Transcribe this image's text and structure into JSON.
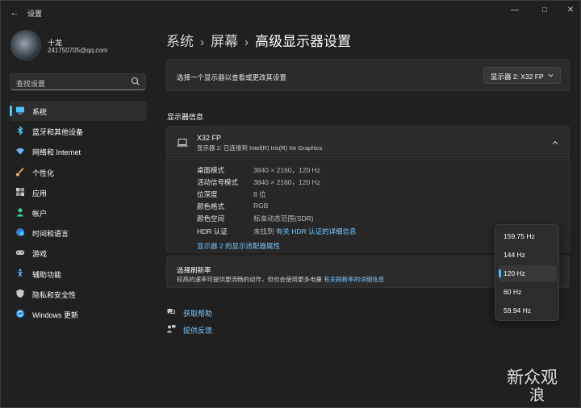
{
  "window": {
    "title": "设置"
  },
  "profile": {
    "name": "十龙",
    "email": "241750705@qq.com"
  },
  "search": {
    "placeholder": "查找设置"
  },
  "sidebar": {
    "items": [
      {
        "label": "系统",
        "icon": "monitor-icon",
        "color": "#4cc2ff"
      },
      {
        "label": "蓝牙和其他设备",
        "icon": "bluetooth-icon",
        "color": "#4cc2ff"
      },
      {
        "label": "网络和 Internet",
        "icon": "wifi-icon",
        "color": "#6fb4ff"
      },
      {
        "label": "个性化",
        "icon": "brush-icon",
        "color": "#f0a050"
      },
      {
        "label": "应用",
        "icon": "apps-icon",
        "color": "#c8c8c8"
      },
      {
        "label": "帐户",
        "icon": "person-icon",
        "color": "#3ccf8e"
      },
      {
        "label": "时间和语言",
        "icon": "globe-clock-icon",
        "color": "#4cc2ff"
      },
      {
        "label": "游戏",
        "icon": "gamepad-icon",
        "color": "#c8c8c8"
      },
      {
        "label": "辅助功能",
        "icon": "accessibility-icon",
        "color": "#5fb0ff"
      },
      {
        "label": "隐私和安全性",
        "icon": "shield-icon",
        "color": "#c8c8c8"
      },
      {
        "label": "Windows 更新",
        "icon": "sync-icon",
        "color": "#4cc2ff"
      }
    ]
  },
  "breadcrumb": {
    "part1": "系统",
    "part2": "屏幕",
    "current": "高级显示器设置"
  },
  "select_display": {
    "label": "选择一个显示器以查看或更改其设置",
    "value": "显示器 2: X32 FP"
  },
  "display_info": {
    "section_title": "显示器信息",
    "name": "X32 FP",
    "connection": "显示器 2: 已连接到 Intel(R) Iris(R) Xe Graphics",
    "properties": [
      {
        "key": "桌面模式",
        "value": "3840 × 2160，120 Hz"
      },
      {
        "key": "活动信号模式",
        "value": "3840 × 2160，120 Hz"
      },
      {
        "key": "位深度",
        "value": "8 位"
      },
      {
        "key": "颜色格式",
        "value": "RGB"
      },
      {
        "key": "颜色空间",
        "value": "标准动态范围(SDR)"
      }
    ],
    "hdr": {
      "key": "HDR 认证",
      "value_prefix": "未找到",
      "value_link": "有关 HDR 认证的详细信息"
    },
    "adapter_link": "显示器 2 的显示适配器属性"
  },
  "refresh_rate": {
    "title": "选择刷新率",
    "description": "较高的速率可提供更流畅的动作，但也会使用更多电量",
    "link": "有关刷新率的详细信息"
  },
  "refresh_options": [
    "159.75 Hz",
    "144 Hz",
    "120 Hz",
    "60 Hz",
    "59.94 Hz"
  ],
  "refresh_selected": "120 Hz",
  "footer": {
    "help": "获取帮助",
    "feedback": "提供反馈"
  },
  "watermark": {
    "line1": "新众观",
    "line2": "浪"
  },
  "colors": {
    "accent": "#4cc2ff",
    "link": "#7cc7ff",
    "background": "#202020",
    "card": "#2b2b2b"
  }
}
